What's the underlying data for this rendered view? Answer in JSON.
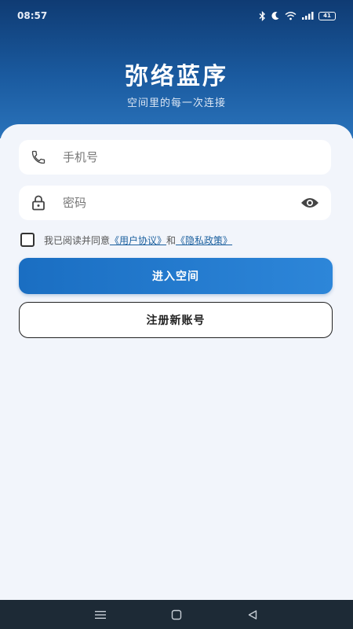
{
  "status_bar": {
    "time": "08:57",
    "icons": [
      "bluetooth-icon",
      "moon-icon",
      "wifi-icon",
      "signal-icon",
      "battery-icon"
    ],
    "battery_level": "41"
  },
  "header": {
    "title": "弥络蓝序",
    "subtitle": "空间里的每一次连接"
  },
  "form": {
    "phone_placeholder": "手机号",
    "password_placeholder": "密码",
    "agreement": {
      "prefix": "我已阅读并同意",
      "user_agreement": "《用户协议》",
      "conjunction": "和",
      "privacy_policy": "《隐私政策》",
      "checked": false
    },
    "login_button": "进入空间",
    "register_button": "注册新账号"
  },
  "colors": {
    "header_gradient_top": "#0f3b73",
    "header_gradient_bottom": "#2a73bb",
    "primary_button": "#1a6ec2",
    "link": "#1a5f9e",
    "card_background": "#f2f5fb",
    "nav_bar": "#1d2a36"
  },
  "nav_bar": {
    "icons": [
      "menu-icon",
      "home-square-icon",
      "back-triangle-icon"
    ]
  }
}
